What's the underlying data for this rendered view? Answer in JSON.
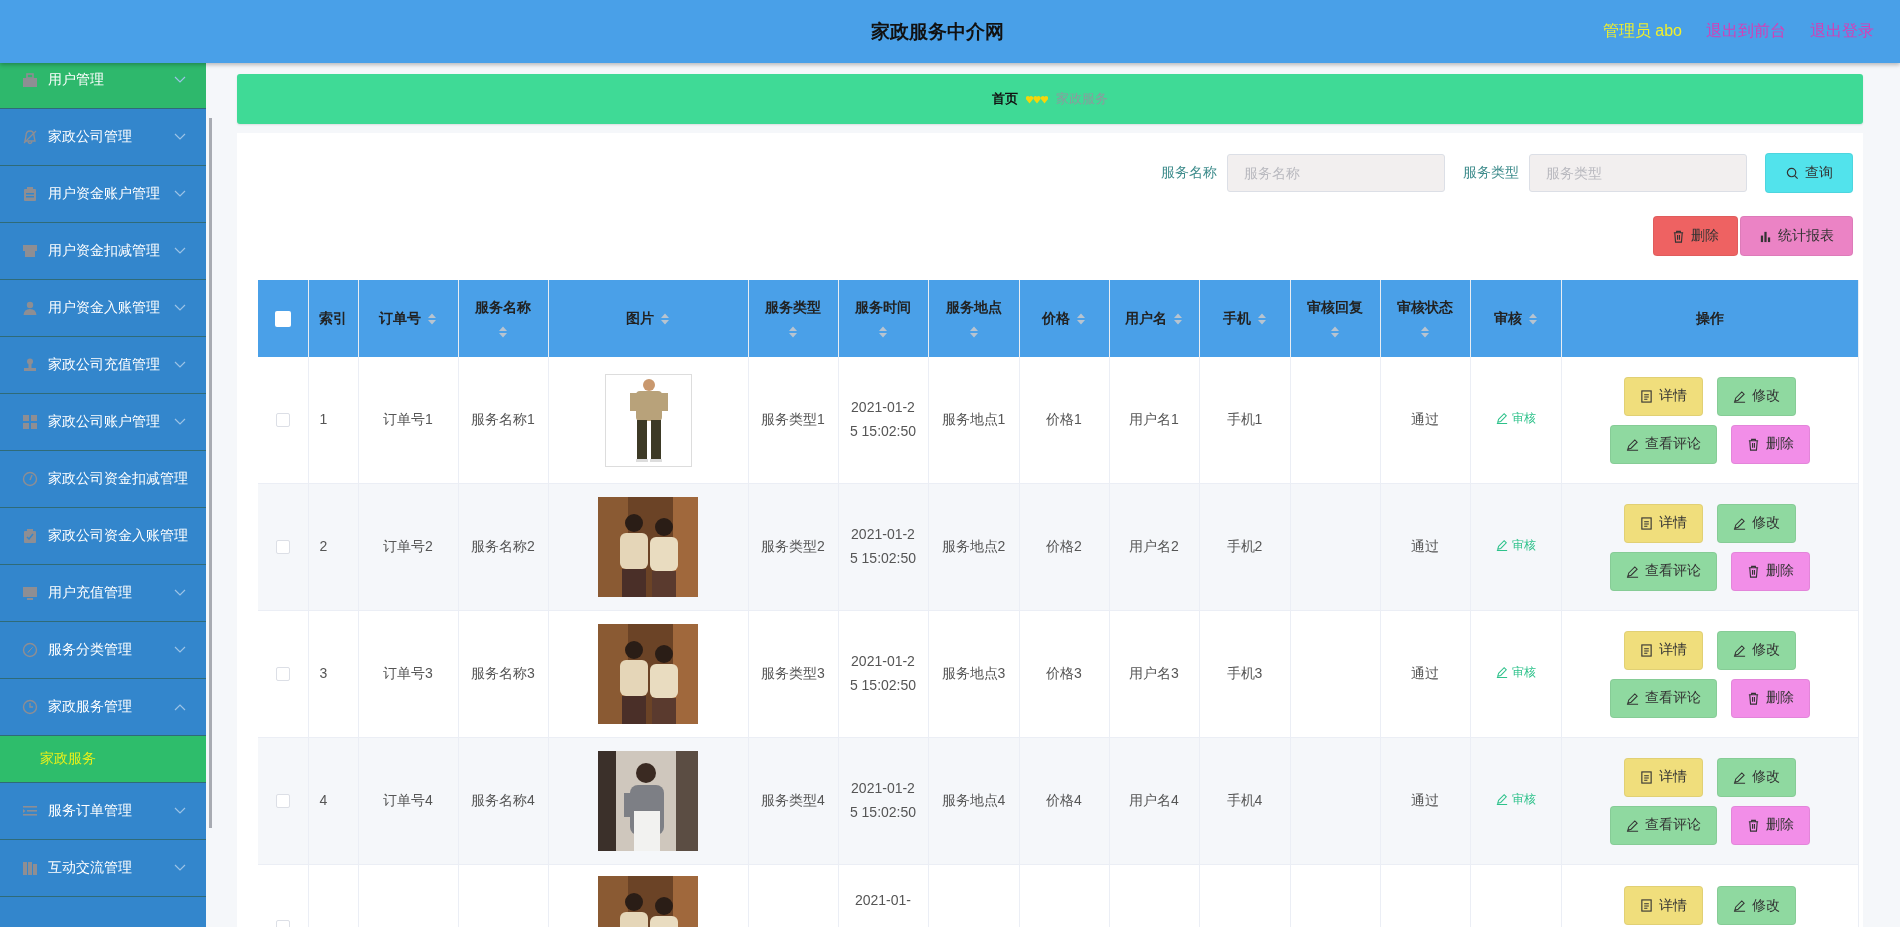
{
  "header": {
    "title": "家政服务中介网",
    "user": "管理员 abo",
    "links": [
      "退出到前台",
      "退出登录"
    ]
  },
  "sidebar": {
    "items": [
      {
        "label": "用户管理",
        "selected": true,
        "expandable": true,
        "expanded": false
      },
      {
        "label": "家政公司管理",
        "selected": false,
        "expandable": true,
        "expanded": false
      },
      {
        "label": "用户资金账户管理",
        "selected": false,
        "expandable": true,
        "expanded": false
      },
      {
        "label": "用户资金扣减管理",
        "selected": false,
        "expandable": true,
        "expanded": false
      },
      {
        "label": "用户资金入账管理",
        "selected": false,
        "expandable": true,
        "expanded": false
      },
      {
        "label": "家政公司充值管理",
        "selected": false,
        "expandable": true,
        "expanded": false
      },
      {
        "label": "家政公司账户管理",
        "selected": false,
        "expandable": true,
        "expanded": false
      },
      {
        "label": "家政公司资金扣减管理",
        "selected": false,
        "expandable": false
      },
      {
        "label": "家政公司资金入账管理",
        "selected": false,
        "expandable": false
      },
      {
        "label": "用户充值管理",
        "selected": false,
        "expandable": true,
        "expanded": false
      },
      {
        "label": "服务分类管理",
        "selected": false,
        "expandable": true,
        "expanded": false
      },
      {
        "label": "家政服务管理",
        "selected": false,
        "expandable": true,
        "expanded": true,
        "children": [
          {
            "label": "家政服务",
            "selected": true
          }
        ]
      },
      {
        "label": "服务订单管理",
        "selected": false,
        "expandable": true,
        "expanded": false
      },
      {
        "label": "互动交流管理",
        "selected": false,
        "expandable": true,
        "expanded": false
      }
    ]
  },
  "breadcrumb": {
    "home": "首页",
    "current": "家政服务"
  },
  "search": {
    "fields": [
      {
        "label": "服务名称",
        "placeholder": "服务名称"
      },
      {
        "label": "服务类型",
        "placeholder": "服务类型"
      }
    ],
    "button": "查询"
  },
  "toolbar": [
    {
      "kind": "delete",
      "label": "删除"
    },
    {
      "kind": "report",
      "label": "统计报表"
    }
  ],
  "table": {
    "select_all": {
      "checked": false
    },
    "columns": [
      {
        "label": "索引",
        "sortable": false
      },
      {
        "label": "订单号",
        "sortable": true
      },
      {
        "label": "服务名称",
        "sortable": true
      },
      {
        "label": "图片",
        "sortable": true
      },
      {
        "label": "服务类型",
        "sortable": true
      },
      {
        "label": "服务时间",
        "sortable": true
      },
      {
        "label": "服务地点",
        "sortable": true
      },
      {
        "label": "价格",
        "sortable": true
      },
      {
        "label": "用户名",
        "sortable": true
      },
      {
        "label": "手机",
        "sortable": true
      },
      {
        "label": "审核回复",
        "sortable": true
      },
      {
        "label": "审核状态",
        "sortable": true
      },
      {
        "label": "审核",
        "sortable": true
      },
      {
        "label": "操作",
        "sortable": false
      }
    ],
    "rows": [
      {
        "checked": false,
        "cells": [
          "1",
          "订单号1",
          "服务名称1",
          {
            "kind": "picture"
          },
          "服务类型1",
          "2021-01-25 15:02:50",
          "服务地点1",
          "价格1",
          "用户名1",
          "手机1",
          "",
          "通过",
          {
            "kind": "link",
            "label": "审核"
          },
          {
            "kind": "actions",
            "actions": [
              {
                "kind": "detail",
                "label": "详情"
              },
              {
                "kind": "edit",
                "label": "修改"
              },
              {
                "kind": "comments",
                "label": "查看评论"
              },
              {
                "kind": "delete",
                "label": "删除"
              }
            ]
          }
        ]
      },
      {
        "checked": false,
        "cells": [
          "2",
          "订单号2",
          "服务名称2",
          {
            "kind": "picture"
          },
          "服务类型2",
          "2021-01-25 15:02:50",
          "服务地点2",
          "价格2",
          "用户名2",
          "手机2",
          "",
          "通过",
          {
            "kind": "link",
            "label": "审核"
          },
          {
            "kind": "actions",
            "actions": [
              {
                "kind": "detail",
                "label": "详情"
              },
              {
                "kind": "edit",
                "label": "修改"
              },
              {
                "kind": "comments",
                "label": "查看评论"
              },
              {
                "kind": "delete",
                "label": "删除"
              }
            ]
          }
        ]
      },
      {
        "checked": false,
        "cells": [
          "3",
          "订单号3",
          "服务名称3",
          {
            "kind": "picture"
          },
          "服务类型3",
          "2021-01-25 15:02:50",
          "服务地点3",
          "价格3",
          "用户名3",
          "手机3",
          "",
          "通过",
          {
            "kind": "link",
            "label": "审核"
          },
          {
            "kind": "actions",
            "actions": [
              {
                "kind": "detail",
                "label": "详情"
              },
              {
                "kind": "edit",
                "label": "修改"
              },
              {
                "kind": "comments",
                "label": "查看评论"
              },
              {
                "kind": "delete",
                "label": "删除"
              }
            ]
          }
        ]
      },
      {
        "checked": false,
        "cells": [
          "4",
          "订单号4",
          "服务名称4",
          {
            "kind": "picture"
          },
          "服务类型4",
          "2021-01-25 15:02:50",
          "服务地点4",
          "价格4",
          "用户名4",
          "手机4",
          "",
          "通过",
          {
            "kind": "link",
            "label": "审核"
          },
          {
            "kind": "actions",
            "actions": [
              {
                "kind": "detail",
                "label": "详情"
              },
              {
                "kind": "edit",
                "label": "修改"
              },
              {
                "kind": "comments",
                "label": "查看评论"
              },
              {
                "kind": "delete",
                "label": "删除"
              }
            ]
          }
        ]
      },
      {
        "checked": false,
        "cells": [
          "",
          "",
          "",
          {
            "kind": "picture"
          },
          "",
          "2021-01-",
          "",
          "",
          "",
          "",
          "",
          "",
          "",
          {
            "kind": "actions",
            "actions": [
              {
                "kind": "detail",
                "label": "详情"
              },
              {
                "kind": "edit",
                "label": "修改"
              }
            ]
          }
        ]
      }
    ]
  }
}
